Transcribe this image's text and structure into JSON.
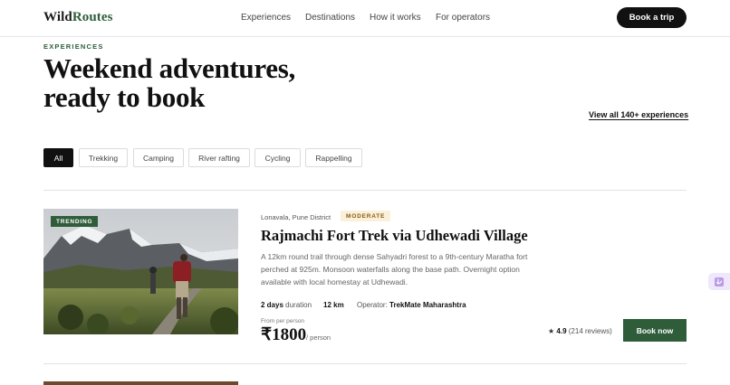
{
  "header": {
    "brand_prefix": "Wild",
    "brand_suffix": "Routes",
    "nav": [
      "Experiences",
      "Destinations",
      "How it works",
      "For operators"
    ],
    "cta": "Book a trip"
  },
  "hero": {
    "eyebrow": "EXPERIENCES",
    "headline_line1": "Weekend adventures,",
    "headline_line2": "ready to book",
    "view_all": "View all 140+ experiences"
  },
  "filters": {
    "items": [
      "All",
      "Trekking",
      "Camping",
      "River rafting",
      "Cycling",
      "Rappelling"
    ],
    "selected": "All"
  },
  "listing": {
    "badge": "TRENDING",
    "location": "Lonavala, Pune District",
    "difficulty": "MODERATE",
    "title": "Rajmachi Fort Trek via Udhewadi Village",
    "description": "A 12km round trail through dense Sahyadri forest to a 9th-century Maratha fort perched at 925m. Monsoon waterfalls along the base path. Overnight option available with local homestay at Udhewadi.",
    "duration_value": "2 days",
    "duration_label": "duration",
    "distance": "12 km",
    "operator_label": "Operator:",
    "operator": "TrekMate Maharashtra",
    "price_label": "From per person",
    "price": "₹1800",
    "price_unit": "/ person",
    "rating": "4.9",
    "reviews": "(214 reviews)",
    "book_label": "Book now"
  },
  "colors": {
    "brand_green": "#2f5d3a",
    "difficulty_bg": "#fbf0d9",
    "difficulty_text": "#8a5a12"
  }
}
